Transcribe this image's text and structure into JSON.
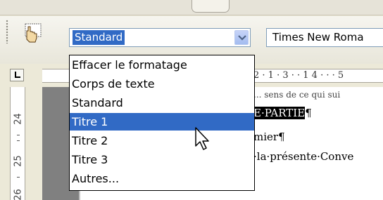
{
  "toolbar": {
    "style_value": "Standard",
    "font_value": "Times New Roma"
  },
  "dropdown": {
    "items": [
      {
        "label": "Effacer le formatage"
      },
      {
        "label": "Corps de texte"
      },
      {
        "label": "Standard"
      },
      {
        "label": "Titre 1",
        "selected": true
      },
      {
        "label": "Titre 2"
      },
      {
        "label": "Titre 3"
      },
      {
        "label": "Autres..."
      }
    ]
  },
  "ruler": {
    "horizontal_text": "2 · 1 · 3 · · 1 4 · · · 5",
    "vertical_numbers": [
      "24",
      "25",
      "26"
    ]
  },
  "document": {
    "line1": "... sens de ce qui sui",
    "line2_selected": "E·PARTIE",
    "line2_mark": "¶",
    "line3": "mier¶",
    "line4": "·la·présente·Conve"
  },
  "icons": {
    "style_icon": "hand-pointer-icon",
    "dropdown_arrow": "chevron-down-icon",
    "cursor": "mouse-pointer-icon"
  },
  "colors": {
    "selection": "#316AC5",
    "toolbar_bg": "#ECE9D8",
    "desk": "#808080"
  }
}
